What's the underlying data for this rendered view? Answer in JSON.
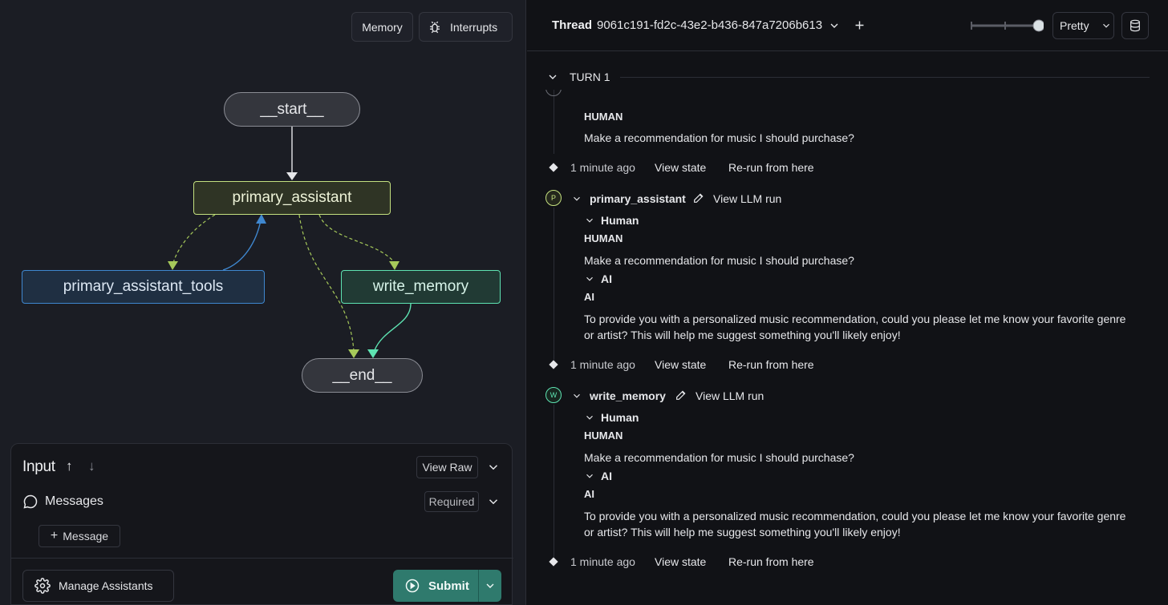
{
  "toolbar": {
    "memory_label": "Memory",
    "interrupts_label": "Interrupts"
  },
  "graph": {
    "nodes": {
      "start": "__start__",
      "primary_assistant": "primary_assistant",
      "primary_assistant_tools": "primary_assistant_tools",
      "write_memory": "write_memory",
      "end": "__end__"
    },
    "colors": {
      "primary": "#c4e07f",
      "tools": "#3f87cf",
      "write": "#5ee3b2"
    }
  },
  "input": {
    "title": "Input",
    "view_raw_label": "View Raw",
    "messages_label": "Messages",
    "required_label": "Required",
    "add_message_label": "Message",
    "manage_assistants_label": "Manage Assistants",
    "submit_label": "Submit"
  },
  "header": {
    "thread_label": "Thread",
    "thread_id": "9061c191-fd2c-43e2-b436-847a7206b613",
    "view_mode": "Pretty"
  },
  "turn": {
    "label": "TURN 1"
  },
  "feed": {
    "first": {
      "role": "HUMAN",
      "message": "Make a recommendation for music I should purchase?",
      "time": "1 minute ago",
      "view_state": "View state",
      "rerun": "Re-run from here"
    },
    "primary": {
      "avatar": "P",
      "node": "primary_assistant",
      "view_llm": "View LLM run",
      "human_toggle": "Human",
      "human_role": "HUMAN",
      "human_message": "Make a recommendation for music I should purchase?",
      "ai_toggle": "AI",
      "ai_role": "AI",
      "ai_message": "To provide you with a personalized music recommendation, could you please let me know your favorite genre or artist? This will help me suggest something you'll likely enjoy!",
      "time": "1 minute ago",
      "view_state": "View state",
      "rerun": "Re-run from here"
    },
    "write": {
      "avatar": "W",
      "node": "write_memory",
      "view_llm": "View LLM run",
      "human_toggle": "Human",
      "human_role": "HUMAN",
      "human_message": "Make a recommendation for music I should purchase?",
      "ai_toggle": "AI",
      "ai_role": "AI",
      "ai_message": "To provide you with a personalized music recommendation, could you please let me know your favorite genre or artist? This will help me suggest something you'll likely enjoy!",
      "time": "1 minute ago",
      "view_state": "View state",
      "rerun": "Re-run from here"
    }
  }
}
